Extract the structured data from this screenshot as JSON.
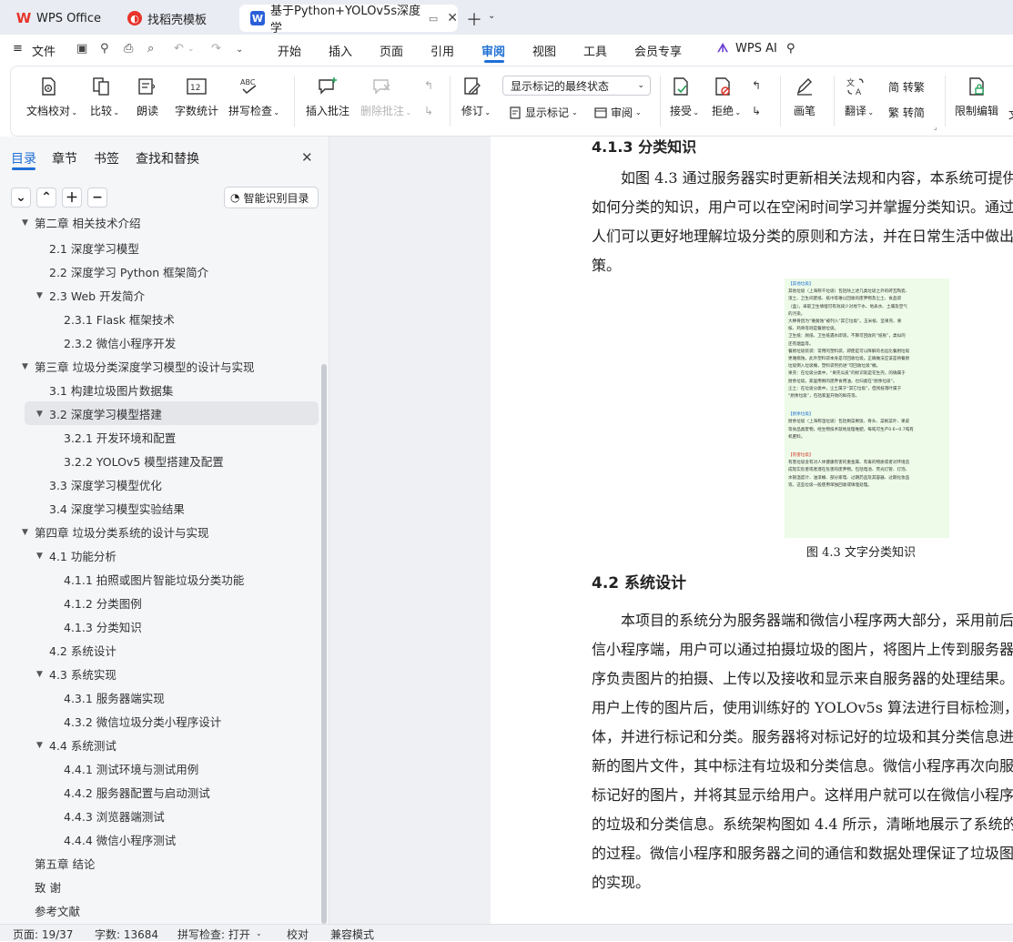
{
  "colors": {
    "accent": "#1f6fd6",
    "wps_red": "#e8342a",
    "docer_red": "#e8342a",
    "wps_blue": "#2b5fd9",
    "figure_bg": "#edfbe8"
  },
  "tabs": [
    {
      "label": "WPS Office"
    },
    {
      "label": "找稻壳模板"
    },
    {
      "label": "基于Python+YOLOv5s深度学"
    }
  ],
  "menu": {
    "file": "文件",
    "items": [
      "开始",
      "插入",
      "页面",
      "引用",
      "审阅",
      "视图",
      "工具",
      "会员专享"
    ],
    "active": "审阅",
    "wps_ai": "WPS AI"
  },
  "ribbon": {
    "doc_check": "文档校对",
    "compare": "比较",
    "read_aloud": "朗读",
    "word_count": "字数统计",
    "spell_check": "拼写检查",
    "insert_comment": "插入批注",
    "delete_comment": "删除批注",
    "revise": "修订",
    "markup_select": "显示标记的最终状态",
    "show_markup": "显示标记",
    "review": "审阅",
    "accept": "接受",
    "reject": "拒绝",
    "pen": "画笔",
    "translate": "翻译",
    "trad": "简 转繁",
    "simp": "繁 转简",
    "restrict": "限制编辑",
    "doc_more": "文"
  },
  "left_panel": {
    "tabs": [
      "目录",
      "章节",
      "书签",
      "查找和替换"
    ],
    "smart_btn": "智能识别目录",
    "toc": [
      {
        "label": "第二章  相关技术介绍"
      },
      {
        "label": "2.1    深度学习模型"
      },
      {
        "label": "2.2    深度学习 Python 框架简介"
      },
      {
        "label": "2.3    Web 开发简介"
      },
      {
        "label": "2.3.1    Flask 框架技术"
      },
      {
        "label": "2.3.2    微信小程序开发"
      },
      {
        "label": "第三章  垃圾分类深度学习模型的设计与实现"
      },
      {
        "label": "3.1    构建垃圾图片数据集"
      },
      {
        "label": "3.2    深度学习模型搭建"
      },
      {
        "label": "3.2.1    开发环境和配置"
      },
      {
        "label": "3.2.2    YOLOv5 模型搭建及配置"
      },
      {
        "label": "3.3    深度学习模型优化"
      },
      {
        "label": "3.4    深度学习模型实验结果"
      },
      {
        "label": "第四章    垃圾分类系统的设计与实现"
      },
      {
        "label": "4.1    功能分析"
      },
      {
        "label": "4.1.1    拍照或图片智能垃圾分类功能"
      },
      {
        "label": "4.1.2    分类图例"
      },
      {
        "label": "4.1.3    分类知识"
      },
      {
        "label": "4.2    系统设计"
      },
      {
        "label": "4.3    系统实现"
      },
      {
        "label": "4.3.1    服务器端实现"
      },
      {
        "label": "4.3.2    微信垃圾分类小程序设计"
      },
      {
        "label": "4.4    系统测试"
      },
      {
        "label": "4.4.1    测试环境与测试用例"
      },
      {
        "label": "4.4.2    服务器配置与启动测试"
      },
      {
        "label": "4.4.3    浏览器端测试"
      },
      {
        "label": "4.4.4    微信小程序测试"
      },
      {
        "label": "第五章    结论"
      },
      {
        "label": "致      谢"
      },
      {
        "label": "参考文献"
      }
    ]
  },
  "document": {
    "h413": "4.1.3    分类知识",
    "p1": [
      "如图 4.3 通过服务器实时更新相关法规和内容，本系统可提供给",
      "如何分类的知识，用户可以在空闲时间学习并掌握分类知识。通过",
      "人们可以更好地理解垃圾分类的原则和方法，并在日常生活中做出",
      "策。"
    ],
    "figure": {
      "h1": "【其他垃圾】",
      "b1": [
        "其他垃圾（上海称干垃圾）包括除上述几类垃圾之外的砖瓦陶瓷、",
        "渣土、卫生间废纸、纸巾等难以回收的废弃物及尘土、食品袋",
        "（盒）。采取卫生填埋可有效减少对地下水、地表水、土壤及空气",
        "的污染。",
        "大棒骨因为“难腐蚀”被列入“其它垃圾”。玉米核、坚果壳、果",
        "核、鸡骨等则是餐厨垃圾。",
        "卫生纸：厕纸、卫生纸遇水即溶，不算可回收的“纸张”，类似的",
        "还有烟盒等。",
        "餐厨垃圾装袋：常用的塑料袋，即使是可以降解的也远比餐厨垃圾",
        "更难腐蚀。此外塑料袋本身是可回收垃圾。正确做法应该是将餐厨",
        "垃圾倒入垃圾桶，塑料袋另扔进“可回收垃圾”桶。",
        "果壳：在垃圾分类中，“果壳瓜皮”的标识就是花生壳，的确属于",
        "厨余垃圾。家里用剩的废弃食用油，也归类在“厨余垃圾”。",
        "尘土：在垃圾分类中，尘土属于“其它垃圾”，但残枝落叶属于",
        "“厨余垃圾”，包括家里开败的鲜花等。"
      ],
      "h2": "【厨余垃圾】",
      "b2": [
        "厨余垃圾（上海称湿垃圾）包括剩菜剩饭、骨头、菜根菜叶、果皮",
        "等食品类废物。经生物技术就地处理堆肥，每吨可生产0.6~0.7吨有",
        "机肥料。"
      ],
      "h3": "【有害垃圾】",
      "b3": [
        "有害垃圾含有对人体健康有害的重金属、有毒的物质或者对环境造",
        "成现实危害或者潜在危害的废弃物。包括电池、荧光灯管、灯泡、",
        "水银温度计、油漆桶、部分家电、过期药品及其容器、过期化妆品",
        "等。这些垃圾一般使用单独回收或填埋处理。"
      ],
      "caption": "图 4.3    文字分类知识"
    },
    "h42": "4.2    系统设计",
    "p2": [
      "本项目的系统分为服务器端和微信小程序两大部分，采用前后端",
      "信小程序端，用户可以通过拍摄垃圾的图片，将图片上传到服务器端",
      "序负责图片的拍摄、上传以及接收和显示来自服务器的处理结果。在",
      "用户上传的图片后，使用训练好的 YOLOv5s 算法进行目标检测，识",
      "体，并进行标记和分类。服务器将对标记好的垃圾和其分类信息进行",
      "新的图片文件，其中标注有垃圾和分类信息。微信小程序再次向服务",
      "标记好的图片，并将其显示给用户。这样用户就可以在微信小程序中",
      "的垃圾和分类信息。系统架构图如 4.4 所示，清晰地展示了系统的组",
      "的过程。微信小程序和服务器之间的通信和数据处理保证了垃圾图片",
      "的实现。"
    ]
  },
  "status": {
    "page": "页面: 19/37",
    "words": "字数: 13684",
    "spell": "拼写检查: 打开",
    "proof": "校对",
    "compat": "兼容模式"
  }
}
